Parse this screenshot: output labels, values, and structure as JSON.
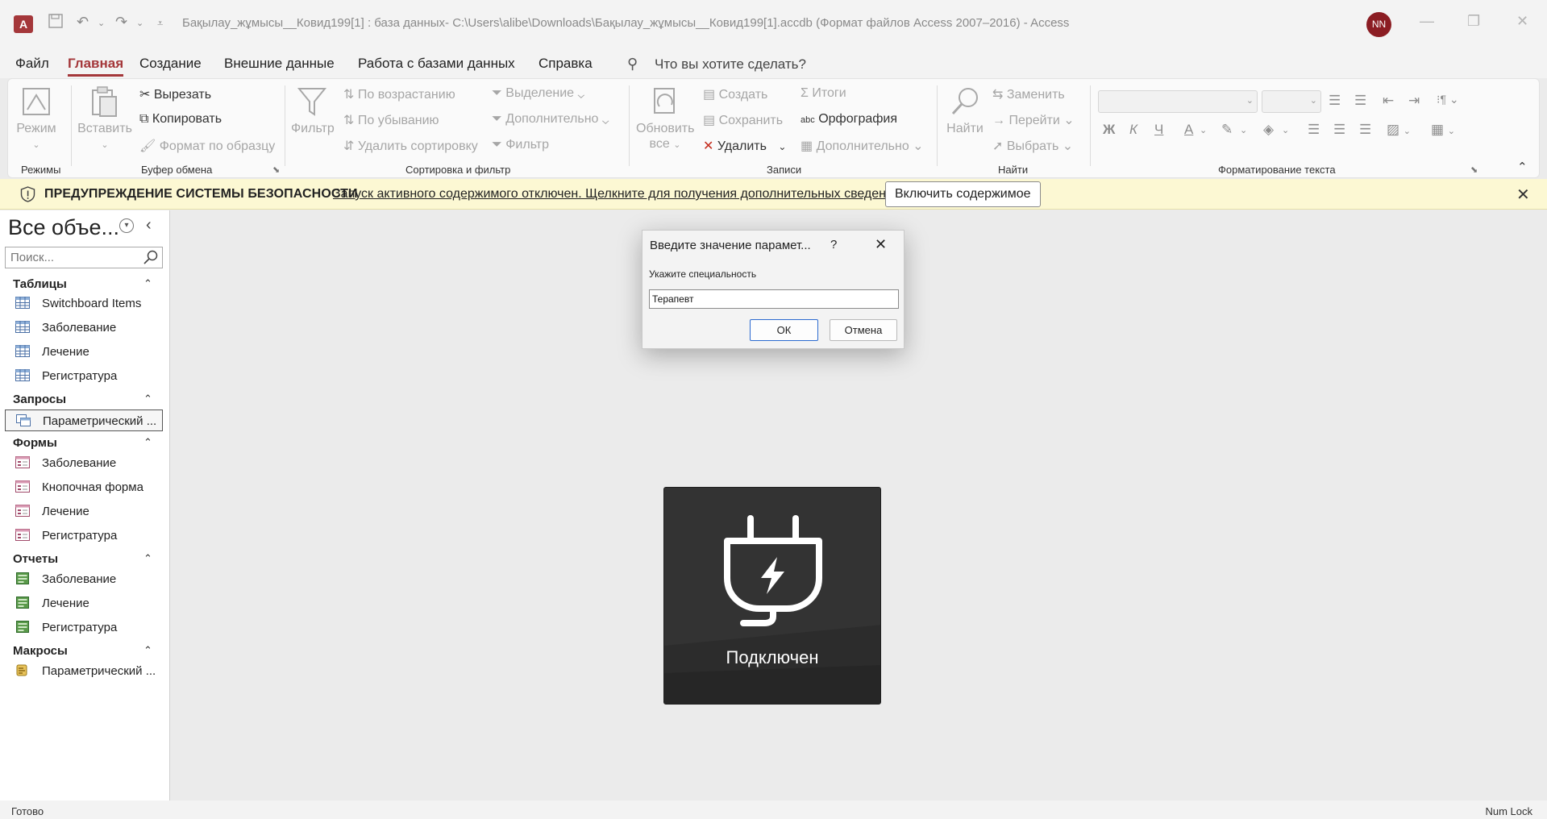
{
  "titlebar": {
    "title": "Бақылау_жұмысы__Ковид199[1] : база данных- C:\\Users\\alibe\\Downloads\\Бақылау_жұмысы__Ковид199[1].accdb (Формат файлов Access 2007–2016)  -  Access",
    "user_initials": "NN",
    "app_logo": "A"
  },
  "menu": {
    "tabs": [
      "Файл",
      "Главная",
      "Создание",
      "Внешние данные",
      "Работа с базами данных",
      "Справка"
    ],
    "tell_me": "Что вы хотите сделать?"
  },
  "ribbon": {
    "groups": {
      "views": "Режимы",
      "clipboard": "Буфер обмена",
      "sort_filter": "Сортировка и фильтр",
      "records": "Записи",
      "find": "Найти",
      "text_format": "Форматирование текста"
    },
    "view": "Режим",
    "paste": "Вставить",
    "cut": "Вырезать",
    "copy": "Копировать",
    "format_painter": "Формат по образцу",
    "filter": "Фильтр",
    "ascending": "По возрастанию",
    "descending": "По убыванию",
    "remove_sort": "Удалить сортировку",
    "selection": "Выделение",
    "advanced": "Дополнительно",
    "toggle_filter": "Фильтр",
    "refresh_line1": "Обновить",
    "refresh_line2": "все",
    "new": "Создать",
    "save": "Сохранить",
    "delete": "Удалить",
    "totals": "Итоги",
    "spelling": "Орфография",
    "more": "Дополнительно",
    "find": "Найти",
    "replace": "Заменить",
    "goto": "Перейти",
    "select": "Выбрать",
    "bold": "Ж",
    "italic": "К",
    "underline": "Ч",
    "font_color": "А"
  },
  "security": {
    "title": "ПРЕДУПРЕЖДЕНИЕ СИСТЕМЫ БЕЗОПАСНОСТИ",
    "message": "Запуск активного содержимого отключен. Щелкните для получения дополнительных сведений.",
    "enable_button": "Включить содержимое"
  },
  "nav": {
    "title": "Все объе...",
    "search_placeholder": "Поиск...",
    "sections": [
      {
        "name": "Таблицы",
        "items": [
          "Switchboard Items",
          "Заболевание",
          "Лечение",
          "Регистратура"
        ]
      },
      {
        "name": "Запросы",
        "items": [
          "Параметрический ..."
        ]
      },
      {
        "name": "Формы",
        "items": [
          "Заболевание",
          "Кнопочная форма",
          "Лечение",
          "Регистратура"
        ]
      },
      {
        "name": "Отчеты",
        "items": [
          "Заболевание",
          "Лечение",
          "Регистратура"
        ]
      },
      {
        "name": "Макросы",
        "items": [
          "Параметрический ..."
        ]
      }
    ]
  },
  "dialog": {
    "title": "Введите значение парамет...",
    "help": "?",
    "prompt": "Укажите специальность",
    "value": "Терапевт",
    "ok": "ОК",
    "cancel": "Отмена"
  },
  "tile": {
    "label": "Подключен"
  },
  "status": {
    "left": "Готово",
    "right": "Num Lock"
  }
}
